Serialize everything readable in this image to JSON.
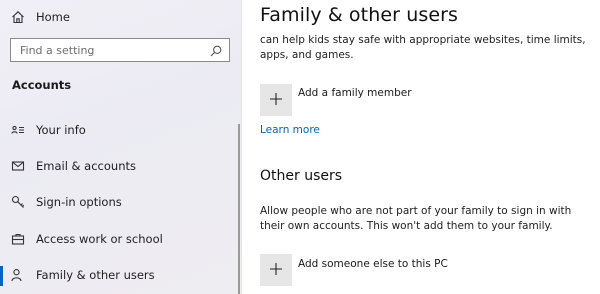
{
  "sidebar": {
    "home_label": "Home",
    "search_placeholder": "Find a setting",
    "section_title": "Accounts",
    "items": [
      {
        "label": "Your info",
        "icon": "person-card-icon"
      },
      {
        "label": "Email & accounts",
        "icon": "mail-icon"
      },
      {
        "label": "Sign-in options",
        "icon": "key-icon"
      },
      {
        "label": "Access work or school",
        "icon": "briefcase-icon"
      },
      {
        "label": "Family & other users",
        "icon": "person-add-icon",
        "selected": true
      }
    ],
    "accent_color": "#0067c0"
  },
  "main": {
    "title": "Family & other users",
    "intro_text": "can help kids stay safe with appropriate websites, time limits, apps, and games.",
    "add_family_label": "Add a family member",
    "learn_more": "Learn more",
    "other_users_heading": "Other users",
    "other_users_desc": "Allow people who are not part of your family to sign in with their own accounts. This won't add them to your family.",
    "add_other_label": "Add someone else to this PC",
    "link_color": "#0066b4"
  }
}
